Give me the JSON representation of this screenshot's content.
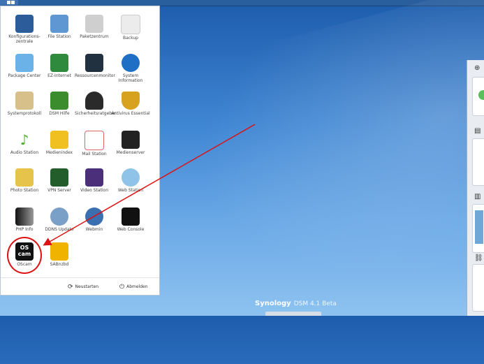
{
  "desktop": {
    "brand": "Synology",
    "version": "DSM 4.1 Beta"
  },
  "colors": {
    "accent": "#d11",
    "desktop": "#3f86d3"
  },
  "menu": {
    "apps": [
      {
        "label": "Konfigurations-zentrale",
        "icon": "control-panel-icon"
      },
      {
        "label": "File Station",
        "icon": "file-station-icon"
      },
      {
        "label": "Paketzentrum",
        "icon": "package-center-icon"
      },
      {
        "label": "Backup",
        "icon": "backup-icon"
      },
      {
        "label": "Package Center",
        "icon": "package-icon"
      },
      {
        "label": "EZ-Internet",
        "icon": "ez-internet-icon"
      },
      {
        "label": "Ressourcenmonitor",
        "icon": "resource-monitor-icon"
      },
      {
        "label": "System Information",
        "icon": "info-icon"
      },
      {
        "label": "Systemprotokoll",
        "icon": "log-icon"
      },
      {
        "label": "DSM Hilfe",
        "icon": "help-icon"
      },
      {
        "label": "Sicherheitsratgeber",
        "icon": "security-advisor-icon"
      },
      {
        "label": "Antivirus Essential",
        "icon": "antivirus-icon"
      },
      {
        "label": "Audio Station",
        "icon": "audio-station-icon"
      },
      {
        "label": "Medienindex",
        "icon": "media-index-icon"
      },
      {
        "label": "Mail Station",
        "icon": "mail-station-icon"
      },
      {
        "label": "Medienserver",
        "icon": "media-server-icon"
      },
      {
        "label": "Photo Station",
        "icon": "photo-station-icon"
      },
      {
        "label": "VPN Server",
        "icon": "vpn-server-icon"
      },
      {
        "label": "Video Station",
        "icon": "video-station-icon"
      },
      {
        "label": "Web Station",
        "icon": "web-station-icon"
      },
      {
        "label": "PHP Info",
        "icon": "php-info-icon"
      },
      {
        "label": "DDNS Update",
        "icon": "ddns-icon"
      },
      {
        "label": "Webmin",
        "icon": "webmin-icon"
      },
      {
        "label": "Web Console",
        "icon": "web-console-icon"
      },
      {
        "label": "OScam",
        "icon": "oscam-icon"
      },
      {
        "label": "SABnzbd",
        "icon": "sabnzbd-icon"
      }
    ],
    "oscam_logo_line1": "OS",
    "oscam_logo_line2": "cam",
    "restart_label": "Neustarten",
    "shutdown_label": "Abmelden"
  }
}
